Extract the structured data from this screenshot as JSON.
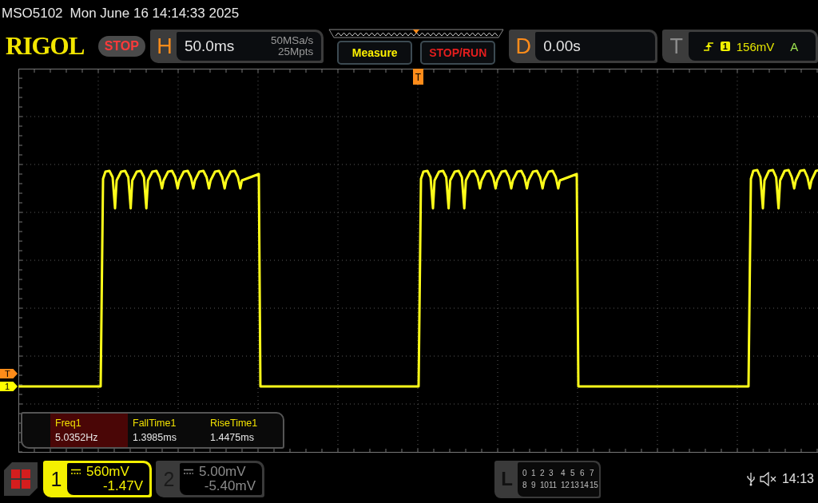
{
  "title_bar": {
    "model": "MSO5102",
    "datetime": "Mon June 16 14:14:33 2025"
  },
  "header": {
    "logo": "RIGOL",
    "run_state": "STOP",
    "horizontal": {
      "label": "H",
      "timebase": "50.0ms",
      "sample_rate": "50MSa/s",
      "memory_depth": "25Mpts"
    },
    "buttons": [
      {
        "label": "Measure",
        "kind": "menu"
      },
      {
        "label": "STOP/RUN",
        "kind": "run"
      }
    ],
    "delay": {
      "label": "D",
      "value": "0.00s"
    },
    "trigger": {
      "label": "T",
      "source": "1",
      "level": "156mV",
      "mode": "A"
    }
  },
  "screen": {
    "trigger_position_marker": "T",
    "level_markers": [
      {
        "label": "T",
        "color": "#ff8c1a"
      },
      {
        "label": "1",
        "color": "#ffff00"
      }
    ],
    "measurements": [
      {
        "name": "Freq1",
        "value": "5.0352Hz",
        "selected": true
      },
      {
        "name": "FallTime1",
        "value": "1.3985ms",
        "selected": false
      },
      {
        "name": "RiseTime1",
        "value": "1.4475ms",
        "selected": false
      }
    ]
  },
  "footer": {
    "channels": [
      {
        "number": "1",
        "scale": "560mV",
        "offset": "-1.47V",
        "on": true
      },
      {
        "number": "2",
        "scale": "5.00mV",
        "offset": "-5.40mV",
        "on": false
      }
    ],
    "logic": {
      "label": "L",
      "rows": [
        [
          "0",
          "1",
          "2",
          "3",
          "4",
          "5",
          "6",
          "7"
        ],
        [
          "8",
          "9",
          "10",
          "11",
          "12",
          "13",
          "14",
          "15"
        ]
      ]
    },
    "time": "14:13"
  }
}
